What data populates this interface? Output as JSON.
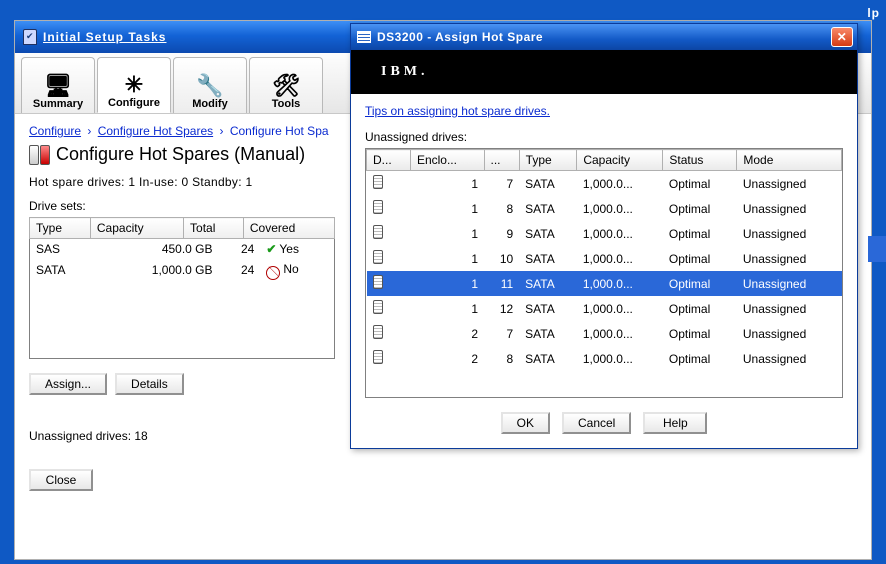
{
  "background_help_stub": "lp",
  "main": {
    "title": "Initial Setup Tasks",
    "tabs": [
      {
        "label": "Summary",
        "icon": "🖥"
      },
      {
        "label": "Configure",
        "icon": "✳"
      },
      {
        "label": "Modify",
        "icon": "🔧"
      },
      {
        "label": "Tools",
        "icon": "🛠"
      }
    ],
    "breadcrumb": [
      "Configure",
      "Configure Hot Spares",
      "Configure Hot Spa"
    ],
    "page_title": "Configure Hot Spares (Manual)",
    "stats_line": "Hot spare drives: 1  In-use: 0  Standby: 1",
    "drive_sets_label": "Drive sets:",
    "drive_sets": {
      "headers": [
        "Type",
        "Capacity",
        "Total",
        "Covered"
      ],
      "rows": [
        {
          "type": "SAS",
          "capacity": "450.0 GB",
          "total": "24",
          "covered": "Yes",
          "covered_ok": true,
          "selected": false
        },
        {
          "type": "SATA",
          "capacity": "1,000.0 GB",
          "total": "24",
          "covered": "No",
          "covered_ok": false,
          "selected": true
        }
      ]
    },
    "buttons": {
      "assign": "Assign...",
      "details": "Details"
    },
    "unassigned_line": "Unassigned drives: 18",
    "close": "Close"
  },
  "dialog": {
    "title": "DS3200 - Assign Hot Spare",
    "brand": "IBM.",
    "tips_link": "Tips on assigning hot spare drives.",
    "unassigned_label": "Unassigned drives:",
    "headers": [
      "D...",
      "Enclo...",
      "...",
      "Type",
      "Capacity",
      "Status",
      "Mode"
    ],
    "rows": [
      {
        "enclo": "1",
        "slot": "7",
        "type": "SATA",
        "capacity": "1,000.0...",
        "status": "Optimal",
        "mode": "Unassigned",
        "selected": false
      },
      {
        "enclo": "1",
        "slot": "8",
        "type": "SATA",
        "capacity": "1,000.0...",
        "status": "Optimal",
        "mode": "Unassigned",
        "selected": false
      },
      {
        "enclo": "1",
        "slot": "9",
        "type": "SATA",
        "capacity": "1,000.0...",
        "status": "Optimal",
        "mode": "Unassigned",
        "selected": false
      },
      {
        "enclo": "1",
        "slot": "10",
        "type": "SATA",
        "capacity": "1,000.0...",
        "status": "Optimal",
        "mode": "Unassigned",
        "selected": false
      },
      {
        "enclo": "1",
        "slot": "11",
        "type": "SATA",
        "capacity": "1,000.0...",
        "status": "Optimal",
        "mode": "Unassigned",
        "selected": true
      },
      {
        "enclo": "1",
        "slot": "12",
        "type": "SATA",
        "capacity": "1,000.0...",
        "status": "Optimal",
        "mode": "Unassigned",
        "selected": false
      },
      {
        "enclo": "2",
        "slot": "7",
        "type": "SATA",
        "capacity": "1,000.0...",
        "status": "Optimal",
        "mode": "Unassigned",
        "selected": false
      },
      {
        "enclo": "2",
        "slot": "8",
        "type": "SATA",
        "capacity": "1,000.0...",
        "status": "Optimal",
        "mode": "Unassigned",
        "selected": false
      }
    ],
    "buttons": {
      "ok": "OK",
      "cancel": "Cancel",
      "help": "Help"
    }
  }
}
